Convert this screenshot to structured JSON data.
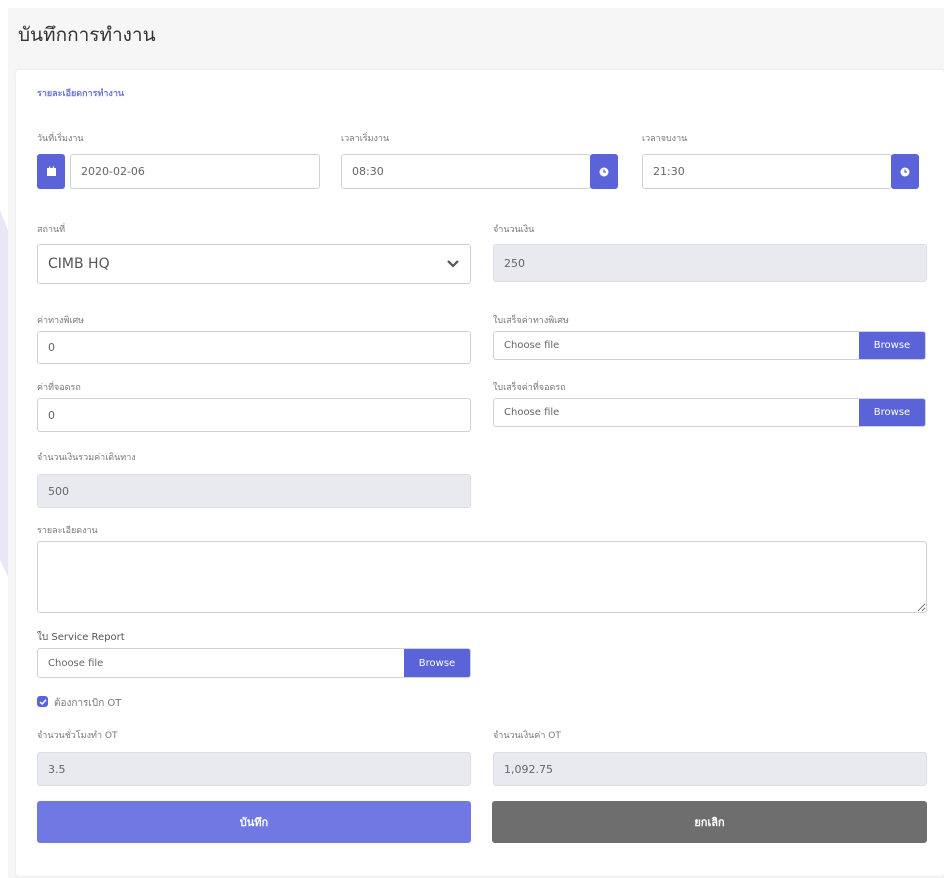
{
  "page": {
    "title": "บันทึกการทำงาน"
  },
  "section": {
    "title": "รายละเอียดการทำงาน"
  },
  "start_date": {
    "label": "วันที่เริ่มงาน",
    "value": "2020-02-06"
  },
  "start_time": {
    "label": "เวลาเริ่มงาน",
    "value": "08:30"
  },
  "end_time": {
    "label": "เวลาจบงาน",
    "value": "21:30"
  },
  "location": {
    "label": "สถานที่",
    "value": "CIMB HQ"
  },
  "amount": {
    "label": "จำนวนเงิน",
    "value": "250"
  },
  "special_travel": {
    "label": "ค่าทางพิเศษ",
    "value": "0"
  },
  "special_travel_receipt": {
    "label": "ใบเสร็จค่าทางพิเศษ",
    "placeholder": "Choose file",
    "browse": "Browse"
  },
  "parking": {
    "label": "ค่าที่จอดรถ",
    "value": "0"
  },
  "parking_receipt": {
    "label": "ใบเสร็จค่าที่จอดรถ",
    "placeholder": "Choose file",
    "browse": "Browse"
  },
  "total_travel": {
    "label": "จำนวนเงินรวมค่าเดินทาง",
    "value": "500"
  },
  "work_detail": {
    "label": "รายละเอียดงาน",
    "value": ""
  },
  "service_report": {
    "label": "ใบ Service Report",
    "placeholder": "Choose file",
    "browse": "Browse"
  },
  "ot_checkbox": {
    "label": "ต้องการเบิก OT",
    "checked": true
  },
  "ot_hours": {
    "label": "จำนวนชั่วโมงทำ OT",
    "value": "3.5"
  },
  "ot_amount": {
    "label": "จำนวนเงินค่า OT",
    "value": "1,092.75"
  },
  "actions": {
    "save": "บันทึก",
    "cancel": "ยกเลิก"
  },
  "colors": {
    "accent": "#5a63d7",
    "cancel": "#6e6e6e"
  }
}
